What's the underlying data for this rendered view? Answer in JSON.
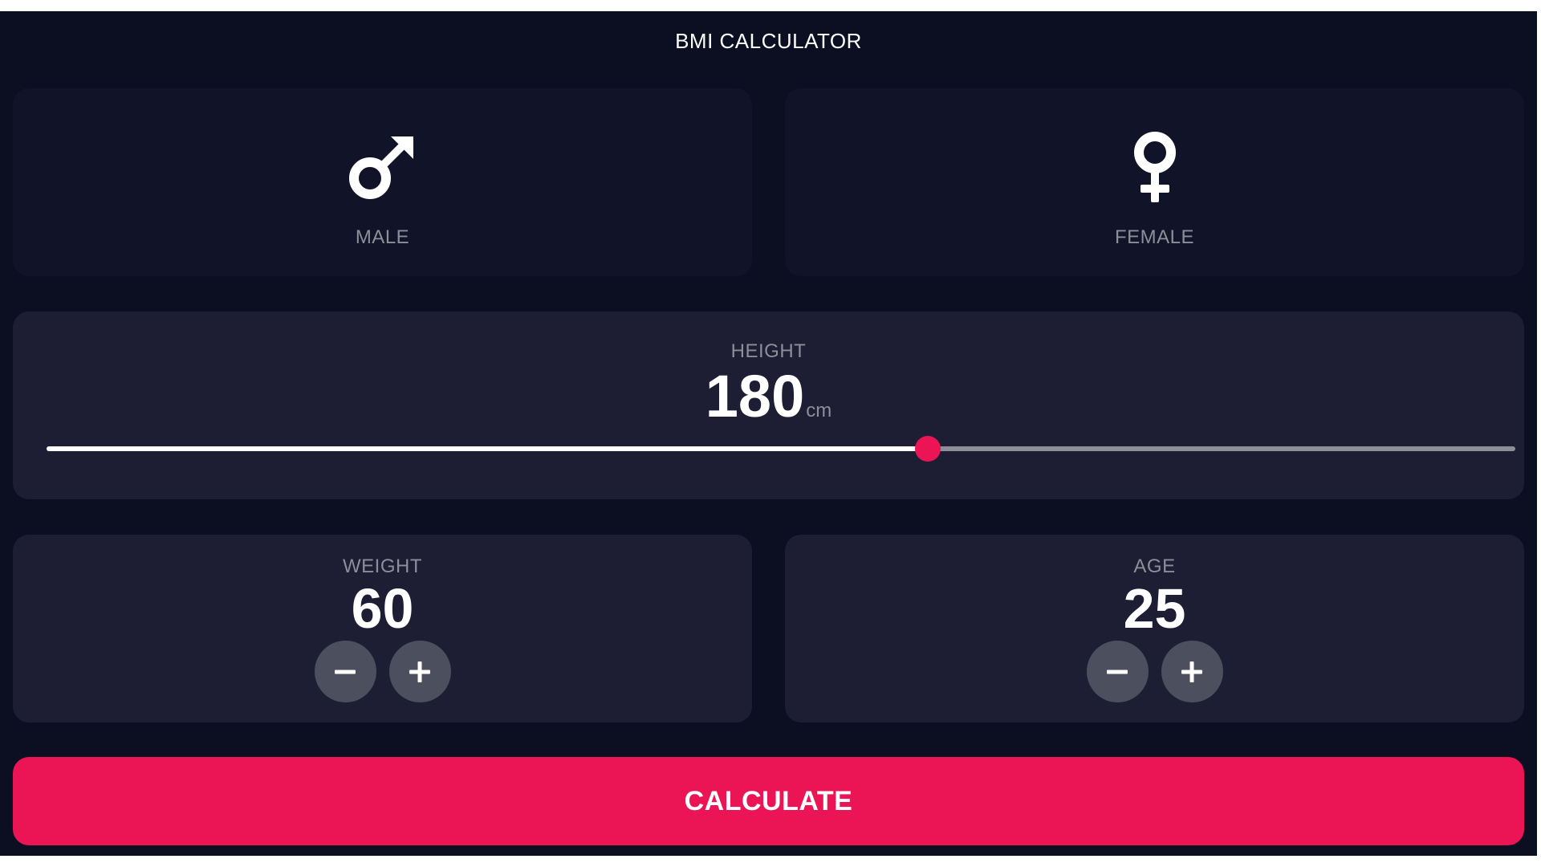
{
  "app": {
    "title": "BMI CALCULATOR",
    "accent_color": "#eb1555",
    "background_color": "#0b0f21",
    "card_color": "#1d1e33",
    "selected_card_color": "#111429"
  },
  "gender": {
    "male": {
      "label": "MALE",
      "icon": "male-symbol-icon"
    },
    "female": {
      "label": "FEMALE",
      "icon": "female-symbol-icon"
    }
  },
  "height": {
    "label": "HEIGHT",
    "value": "180",
    "unit": "cm",
    "slider_fraction": 0.6
  },
  "weight": {
    "label": "WEIGHT",
    "value": "60",
    "decrement_icon": "minus-icon",
    "increment_icon": "plus-icon"
  },
  "age": {
    "label": "AGE",
    "value": "25",
    "decrement_icon": "minus-icon",
    "increment_icon": "plus-icon"
  },
  "calculate": {
    "label": "CALCULATE"
  }
}
